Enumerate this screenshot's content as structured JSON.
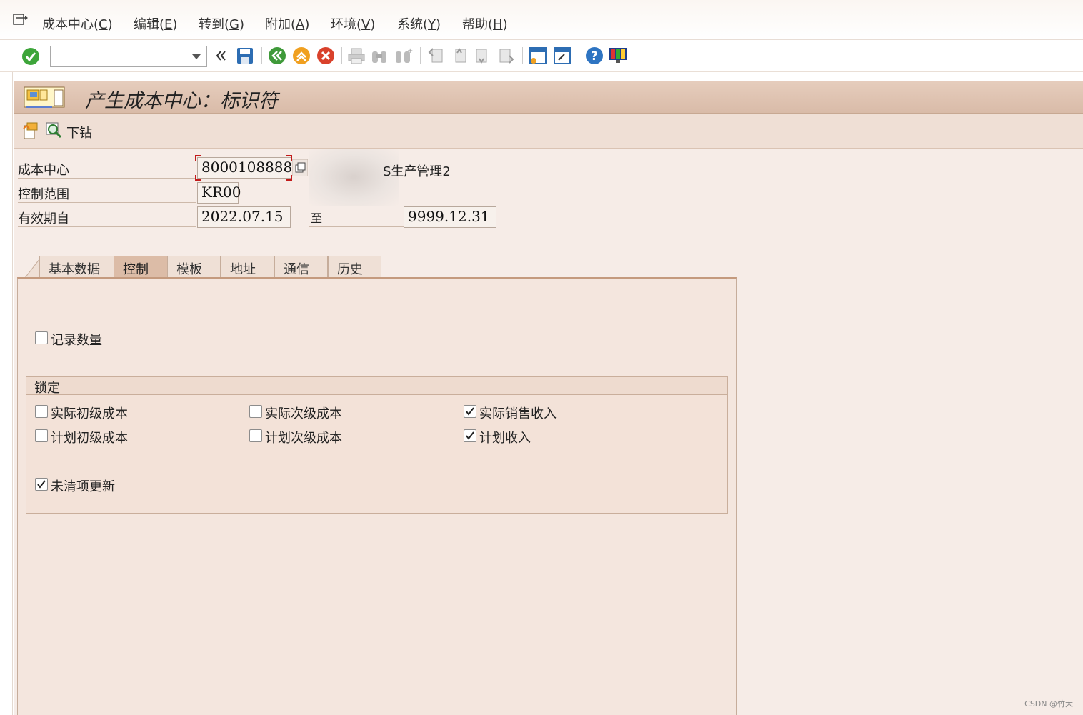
{
  "menubar": {
    "items": [
      {
        "label": "成本中心",
        "accel": "C"
      },
      {
        "label": "编辑",
        "accel": "E"
      },
      {
        "label": "转到",
        "accel": "G"
      },
      {
        "label": "附加",
        "accel": "A"
      },
      {
        "label": "环境",
        "accel": "V"
      },
      {
        "label": "系统",
        "accel": "Y"
      },
      {
        "label": "帮助",
        "accel": "H"
      }
    ]
  },
  "toolbar": {
    "command_value": "",
    "icons": [
      "enter-icon",
      "back-icon",
      "save-icon",
      "back-green-icon",
      "exit-icon",
      "cancel-icon",
      "print-icon",
      "find-icon",
      "find-next-icon",
      "first-page-icon",
      "prev-page-icon",
      "next-page-icon",
      "last-page-icon",
      "create-session-icon",
      "shortcut-icon",
      "help-icon",
      "layout-icon"
    ]
  },
  "screen": {
    "title": "产生成本中心：标识符",
    "drilldown_label": "下钻"
  },
  "header": {
    "cost_center_label": "成本中心",
    "cost_center_value": "8000108888",
    "cost_center_desc": "S生产管理2",
    "controlling_area_label": "控制范围",
    "controlling_area_value": "KR00",
    "valid_from_label": "有效期自",
    "valid_from_value": "2022.07.15",
    "valid_to_label": "至",
    "valid_to_value": "9999.12.31"
  },
  "tabs": [
    {
      "label": "基本数据",
      "active": false
    },
    {
      "label": "控制",
      "active": true
    },
    {
      "label": "模板",
      "active": false
    },
    {
      "label": "地址",
      "active": false
    },
    {
      "label": "通信",
      "active": false
    },
    {
      "label": "历史",
      "active": false
    }
  ],
  "control": {
    "record_quantity": {
      "label": "记录数量",
      "checked": false
    },
    "lock_group_title": "锁定",
    "actual_primary": {
      "label": "实际初级成本",
      "checked": false
    },
    "actual_secondary": {
      "label": "实际次级成本",
      "checked": false
    },
    "actual_revenue": {
      "label": "实际销售收入",
      "checked": true
    },
    "plan_primary": {
      "label": "计划初级成本",
      "checked": false
    },
    "plan_secondary": {
      "label": "计划次级成本",
      "checked": false
    },
    "plan_revenue": {
      "label": "计划收入",
      "checked": true
    },
    "open_items": {
      "label": "未清项更新",
      "checked": true
    }
  },
  "watermark": "CSDN @竹大",
  "colors": {
    "accent": "#c49a7e",
    "title_bar": "#dcbca7",
    "focus_red": "#c21a1a",
    "panel_bg": "#f4e6de"
  }
}
